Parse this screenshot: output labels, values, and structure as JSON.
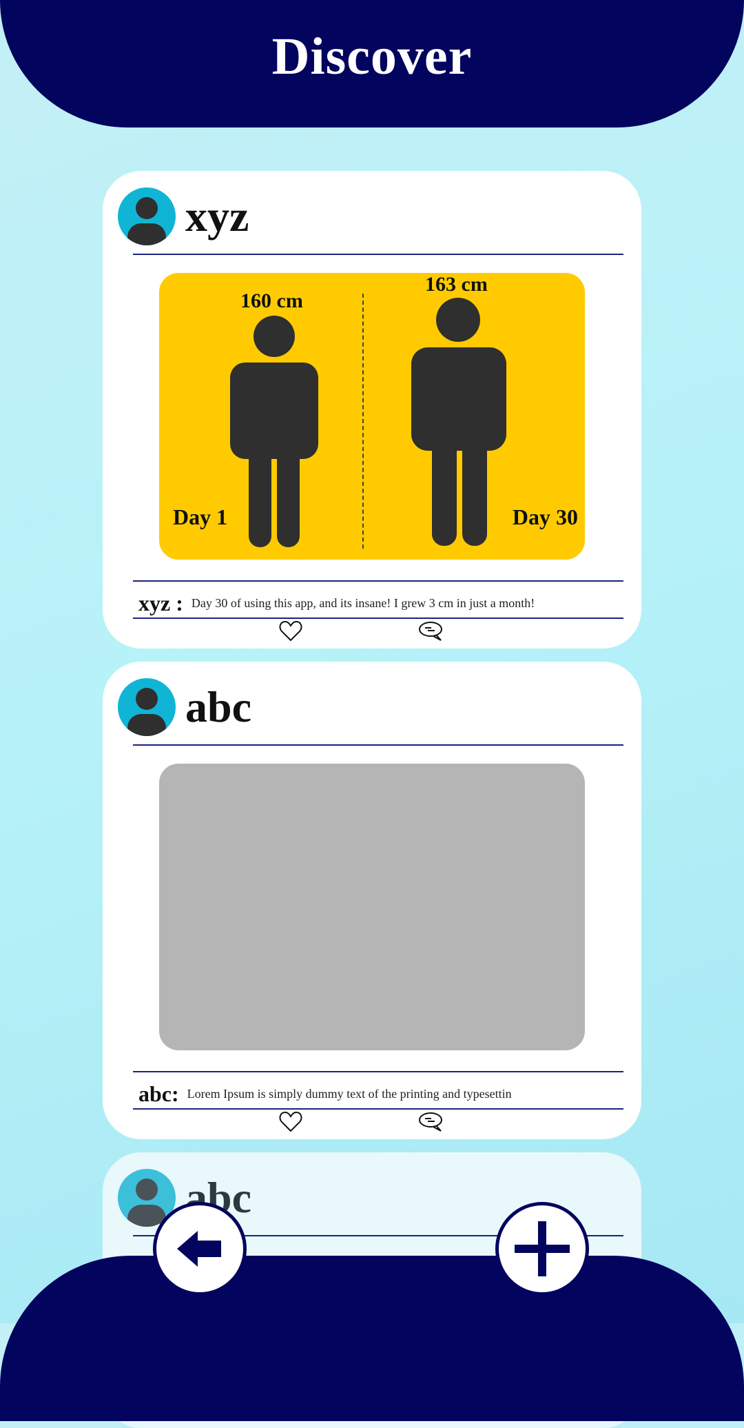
{
  "header": {
    "title": "Discover"
  },
  "posts": [
    {
      "username": "xyz",
      "caption_user": "xyz :",
      "caption": "Day 30 of using this app, and its insane! I grew 3 cm in just a month!",
      "image": {
        "type": "height-comparison",
        "before_height": "160 cm",
        "after_height": "163 cm",
        "before_label": "Day 1",
        "after_label": "Day 30",
        "background": "#ffcb00"
      }
    },
    {
      "username": "abc",
      "caption_user": "abc:",
      "caption": "Lorem Ipsum is simply dummy text of the printing and typesettin",
      "image": {
        "type": "placeholder",
        "background": "#b5b5b5"
      }
    },
    {
      "username": "abc"
    }
  ],
  "icons": {
    "like": "heart-icon",
    "comment": "comment-icon",
    "back": "arrow-left-icon",
    "add": "plus-icon"
  },
  "colors": {
    "primary": "#03045e",
    "avatar": "#10b5d6",
    "accent_yellow": "#ffcb00",
    "placeholder_gray": "#b5b5b5"
  }
}
